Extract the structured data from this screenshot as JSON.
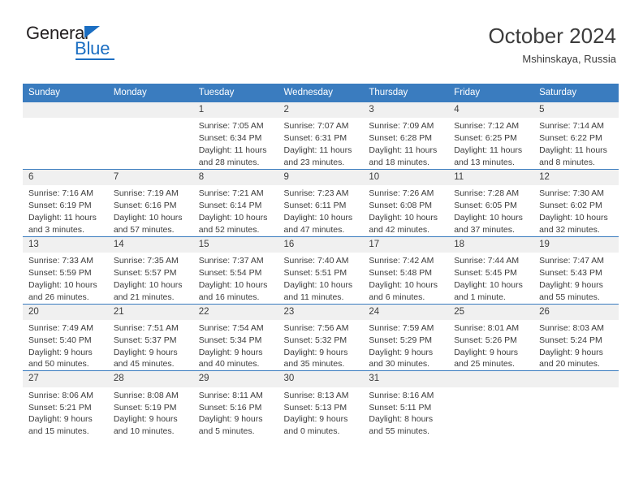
{
  "brand": {
    "name_part1": "General",
    "name_part2": "Blue",
    "triangle_icon": "triangle-icon",
    "accent_color": "#1b6ec2"
  },
  "header": {
    "title": "October 2024",
    "subtitle": "Mshinskaya, Russia",
    "header_bg_color": "#3a7cbf",
    "daynum_bg_color": "#f0f0f0"
  },
  "weekdays": [
    "Sunday",
    "Monday",
    "Tuesday",
    "Wednesday",
    "Thursday",
    "Friday",
    "Saturday"
  ],
  "weeks": [
    [
      {
        "day": "",
        "sunrise": "",
        "sunset": "",
        "daylight": "",
        "empty": true
      },
      {
        "day": "",
        "sunrise": "",
        "sunset": "",
        "daylight": "",
        "empty": true
      },
      {
        "day": "1",
        "sunrise": "Sunrise: 7:05 AM",
        "sunset": "Sunset: 6:34 PM",
        "daylight": "Daylight: 11 hours and 28 minutes.",
        "empty": false
      },
      {
        "day": "2",
        "sunrise": "Sunrise: 7:07 AM",
        "sunset": "Sunset: 6:31 PM",
        "daylight": "Daylight: 11 hours and 23 minutes.",
        "empty": false
      },
      {
        "day": "3",
        "sunrise": "Sunrise: 7:09 AM",
        "sunset": "Sunset: 6:28 PM",
        "daylight": "Daylight: 11 hours and 18 minutes.",
        "empty": false
      },
      {
        "day": "4",
        "sunrise": "Sunrise: 7:12 AM",
        "sunset": "Sunset: 6:25 PM",
        "daylight": "Daylight: 11 hours and 13 minutes.",
        "empty": false
      },
      {
        "day": "5",
        "sunrise": "Sunrise: 7:14 AM",
        "sunset": "Sunset: 6:22 PM",
        "daylight": "Daylight: 11 hours and 8 minutes.",
        "empty": false
      }
    ],
    [
      {
        "day": "6",
        "sunrise": "Sunrise: 7:16 AM",
        "sunset": "Sunset: 6:19 PM",
        "daylight": "Daylight: 11 hours and 3 minutes.",
        "empty": false
      },
      {
        "day": "7",
        "sunrise": "Sunrise: 7:19 AM",
        "sunset": "Sunset: 6:16 PM",
        "daylight": "Daylight: 10 hours and 57 minutes.",
        "empty": false
      },
      {
        "day": "8",
        "sunrise": "Sunrise: 7:21 AM",
        "sunset": "Sunset: 6:14 PM",
        "daylight": "Daylight: 10 hours and 52 minutes.",
        "empty": false
      },
      {
        "day": "9",
        "sunrise": "Sunrise: 7:23 AM",
        "sunset": "Sunset: 6:11 PM",
        "daylight": "Daylight: 10 hours and 47 minutes.",
        "empty": false
      },
      {
        "day": "10",
        "sunrise": "Sunrise: 7:26 AM",
        "sunset": "Sunset: 6:08 PM",
        "daylight": "Daylight: 10 hours and 42 minutes.",
        "empty": false
      },
      {
        "day": "11",
        "sunrise": "Sunrise: 7:28 AM",
        "sunset": "Sunset: 6:05 PM",
        "daylight": "Daylight: 10 hours and 37 minutes.",
        "empty": false
      },
      {
        "day": "12",
        "sunrise": "Sunrise: 7:30 AM",
        "sunset": "Sunset: 6:02 PM",
        "daylight": "Daylight: 10 hours and 32 minutes.",
        "empty": false
      }
    ],
    [
      {
        "day": "13",
        "sunrise": "Sunrise: 7:33 AM",
        "sunset": "Sunset: 5:59 PM",
        "daylight": "Daylight: 10 hours and 26 minutes.",
        "empty": false
      },
      {
        "day": "14",
        "sunrise": "Sunrise: 7:35 AM",
        "sunset": "Sunset: 5:57 PM",
        "daylight": "Daylight: 10 hours and 21 minutes.",
        "empty": false
      },
      {
        "day": "15",
        "sunrise": "Sunrise: 7:37 AM",
        "sunset": "Sunset: 5:54 PM",
        "daylight": "Daylight: 10 hours and 16 minutes.",
        "empty": false
      },
      {
        "day": "16",
        "sunrise": "Sunrise: 7:40 AM",
        "sunset": "Sunset: 5:51 PM",
        "daylight": "Daylight: 10 hours and 11 minutes.",
        "empty": false
      },
      {
        "day": "17",
        "sunrise": "Sunrise: 7:42 AM",
        "sunset": "Sunset: 5:48 PM",
        "daylight": "Daylight: 10 hours and 6 minutes.",
        "empty": false
      },
      {
        "day": "18",
        "sunrise": "Sunrise: 7:44 AM",
        "sunset": "Sunset: 5:45 PM",
        "daylight": "Daylight: 10 hours and 1 minute.",
        "empty": false
      },
      {
        "day": "19",
        "sunrise": "Sunrise: 7:47 AM",
        "sunset": "Sunset: 5:43 PM",
        "daylight": "Daylight: 9 hours and 55 minutes.",
        "empty": false
      }
    ],
    [
      {
        "day": "20",
        "sunrise": "Sunrise: 7:49 AM",
        "sunset": "Sunset: 5:40 PM",
        "daylight": "Daylight: 9 hours and 50 minutes.",
        "empty": false
      },
      {
        "day": "21",
        "sunrise": "Sunrise: 7:51 AM",
        "sunset": "Sunset: 5:37 PM",
        "daylight": "Daylight: 9 hours and 45 minutes.",
        "empty": false
      },
      {
        "day": "22",
        "sunrise": "Sunrise: 7:54 AM",
        "sunset": "Sunset: 5:34 PM",
        "daylight": "Daylight: 9 hours and 40 minutes.",
        "empty": false
      },
      {
        "day": "23",
        "sunrise": "Sunrise: 7:56 AM",
        "sunset": "Sunset: 5:32 PM",
        "daylight": "Daylight: 9 hours and 35 minutes.",
        "empty": false
      },
      {
        "day": "24",
        "sunrise": "Sunrise: 7:59 AM",
        "sunset": "Sunset: 5:29 PM",
        "daylight": "Daylight: 9 hours and 30 minutes.",
        "empty": false
      },
      {
        "day": "25",
        "sunrise": "Sunrise: 8:01 AM",
        "sunset": "Sunset: 5:26 PM",
        "daylight": "Daylight: 9 hours and 25 minutes.",
        "empty": false
      },
      {
        "day": "26",
        "sunrise": "Sunrise: 8:03 AM",
        "sunset": "Sunset: 5:24 PM",
        "daylight": "Daylight: 9 hours and 20 minutes.",
        "empty": false
      }
    ],
    [
      {
        "day": "27",
        "sunrise": "Sunrise: 8:06 AM",
        "sunset": "Sunset: 5:21 PM",
        "daylight": "Daylight: 9 hours and 15 minutes.",
        "empty": false
      },
      {
        "day": "28",
        "sunrise": "Sunrise: 8:08 AM",
        "sunset": "Sunset: 5:19 PM",
        "daylight": "Daylight: 9 hours and 10 minutes.",
        "empty": false
      },
      {
        "day": "29",
        "sunrise": "Sunrise: 8:11 AM",
        "sunset": "Sunset: 5:16 PM",
        "daylight": "Daylight: 9 hours and 5 minutes.",
        "empty": false
      },
      {
        "day": "30",
        "sunrise": "Sunrise: 8:13 AM",
        "sunset": "Sunset: 5:13 PM",
        "daylight": "Daylight: 9 hours and 0 minutes.",
        "empty": false
      },
      {
        "day": "31",
        "sunrise": "Sunrise: 8:16 AM",
        "sunset": "Sunset: 5:11 PM",
        "daylight": "Daylight: 8 hours and 55 minutes.",
        "empty": false
      },
      {
        "day": "",
        "sunrise": "",
        "sunset": "",
        "daylight": "",
        "empty": true
      },
      {
        "day": "",
        "sunrise": "",
        "sunset": "",
        "daylight": "",
        "empty": true
      }
    ]
  ]
}
